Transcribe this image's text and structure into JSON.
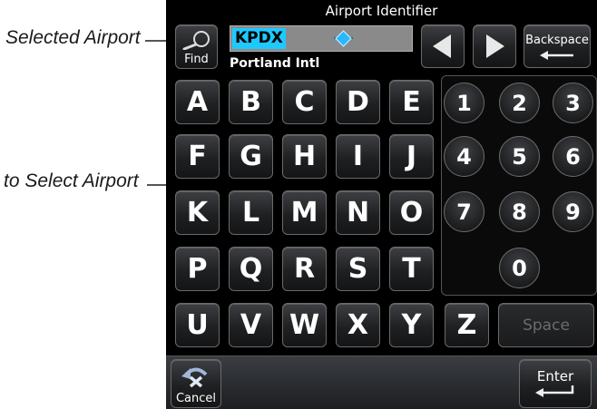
{
  "callouts": {
    "selected_airport": "Selected Airport",
    "select_airport": "to Select Airport"
  },
  "screen": {
    "title": "Airport Identifier",
    "find_label": "Find",
    "identifier_value": "KPDX",
    "airport_name": "Portland Intl",
    "backspace_label": "Backspace",
    "letters": [
      "A",
      "B",
      "C",
      "D",
      "E",
      "F",
      "G",
      "H",
      "I",
      "J",
      "K",
      "L",
      "M",
      "N",
      "O",
      "P",
      "Q",
      "R",
      "S",
      "T",
      "U",
      "V",
      "W",
      "X",
      "Y",
      "Z"
    ],
    "digits": [
      "1",
      "2",
      "3",
      "4",
      "5",
      "6",
      "7",
      "8",
      "9",
      "0"
    ],
    "space_label": "Space",
    "cancel_label": "Cancel",
    "enter_label": "Enter"
  },
  "colors": {
    "highlight": "#1ec9ff",
    "screen_bg": "#000000"
  }
}
